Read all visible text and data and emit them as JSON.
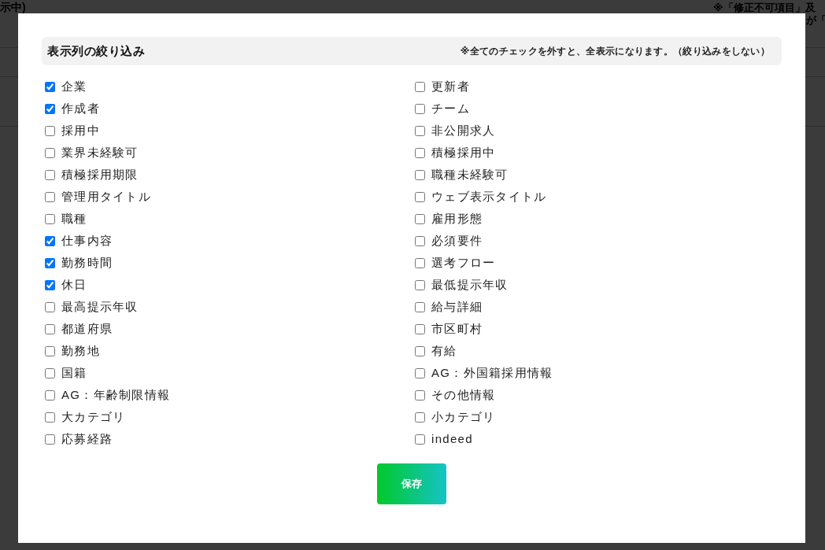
{
  "background": {
    "left_heading": "示中)",
    "right_note": "※「修正不可項目」及",
    "right_note_line_2": "が「"
  },
  "dialog": {
    "header": {
      "title": "表示列の絞り込み",
      "note": "※全てのチェックを外すと、全表示になります。（絞り込みをしない）"
    },
    "options": [
      {
        "label": "企業",
        "checked": true
      },
      {
        "label": "更新者",
        "checked": false
      },
      {
        "label": "作成者",
        "checked": true
      },
      {
        "label": "チーム",
        "checked": false
      },
      {
        "label": "採用中",
        "checked": false
      },
      {
        "label": "非公開求人",
        "checked": false
      },
      {
        "label": "業界未経験可",
        "checked": false
      },
      {
        "label": "積極採用中",
        "checked": false
      },
      {
        "label": "積極採用期限",
        "checked": false
      },
      {
        "label": "職種未経験可",
        "checked": false
      },
      {
        "label": "管理用タイトル",
        "checked": false
      },
      {
        "label": "ウェブ表示タイトル",
        "checked": false
      },
      {
        "label": "職種",
        "checked": false
      },
      {
        "label": "雇用形態",
        "checked": false
      },
      {
        "label": "仕事内容",
        "checked": true
      },
      {
        "label": "必須要件",
        "checked": false
      },
      {
        "label": "勤務時間",
        "checked": true
      },
      {
        "label": "選考フロー",
        "checked": false
      },
      {
        "label": "休日",
        "checked": true
      },
      {
        "label": "最低提示年収",
        "checked": false
      },
      {
        "label": "最高提示年収",
        "checked": false
      },
      {
        "label": "給与詳細",
        "checked": false
      },
      {
        "label": "都道府県",
        "checked": false
      },
      {
        "label": "市区町村",
        "checked": false
      },
      {
        "label": "勤務地",
        "checked": false
      },
      {
        "label": "有給",
        "checked": false
      },
      {
        "label": "国籍",
        "checked": false
      },
      {
        "label": "AG：外国籍採用情報",
        "checked": false
      },
      {
        "label": "AG：年齢制限情報",
        "checked": false
      },
      {
        "label": "その他情報",
        "checked": false
      },
      {
        "label": "大カテゴリ",
        "checked": false
      },
      {
        "label": "小カテゴリ",
        "checked": false
      },
      {
        "label": "応募経路",
        "checked": false
      },
      {
        "label": "indeed",
        "checked": false
      }
    ],
    "save_button": "保存"
  }
}
